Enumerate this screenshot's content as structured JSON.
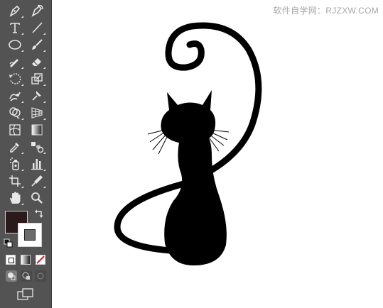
{
  "watermark": "软件自学网：RJZXW.COM",
  "toolbar": {
    "tools": [
      {
        "name": "pen-tool",
        "icon": "pen-icon"
      },
      {
        "name": "curvature-tool",
        "icon": "curvature-pen-icon"
      },
      {
        "name": "type-tool",
        "icon": "type-t-icon",
        "glyph": "T"
      },
      {
        "name": "line-segment-tool",
        "icon": "line-segment-icon"
      },
      {
        "name": "ellipse-tool",
        "icon": "ellipse-icon"
      },
      {
        "name": "paintbrush-tool",
        "icon": "paintbrush-icon"
      },
      {
        "name": "shaper-tool",
        "icon": "shaper-pencil-icon"
      },
      {
        "name": "eraser-tool",
        "icon": "eraser-icon"
      },
      {
        "name": "rotate-tool",
        "icon": "rotate-icon"
      },
      {
        "name": "scale-tool",
        "icon": "scale-icon"
      },
      {
        "name": "warp-tool",
        "icon": "warp-icon"
      },
      {
        "name": "puppet-warp-tool",
        "icon": "puppet-pin-icon"
      },
      {
        "name": "shape-builder-tool",
        "icon": "shape-builder-icon"
      },
      {
        "name": "perspective-grid-tool",
        "icon": "perspective-grid-icon"
      },
      {
        "name": "mesh-tool",
        "icon": "mesh-icon"
      },
      {
        "name": "gradient-tool",
        "icon": "gradient-icon"
      },
      {
        "name": "eyedropper-tool",
        "icon": "eyedropper-icon"
      },
      {
        "name": "blend-tool",
        "icon": "blend-icon"
      },
      {
        "name": "symbol-sprayer-tool",
        "icon": "symbol-sprayer-icon"
      },
      {
        "name": "column-graph-tool",
        "icon": "column-graph-icon"
      },
      {
        "name": "artboard-tool",
        "icon": "artboard-icon"
      },
      {
        "name": "slice-tool",
        "icon": "slice-knife-icon"
      },
      {
        "name": "hand-tool",
        "icon": "hand-icon"
      },
      {
        "name": "zoom-tool",
        "icon": "zoom-magnifier-icon"
      }
    ],
    "fill_color": "#2a1a1c",
    "stroke_inner_color": "#6b6b6b"
  },
  "colors": {
    "toolbar_bg": "#535353",
    "icon": "#e6e6e6",
    "canvas_bg": "#ffffff",
    "artwork": "#000000",
    "none_swatch_slash": "#e02020"
  }
}
